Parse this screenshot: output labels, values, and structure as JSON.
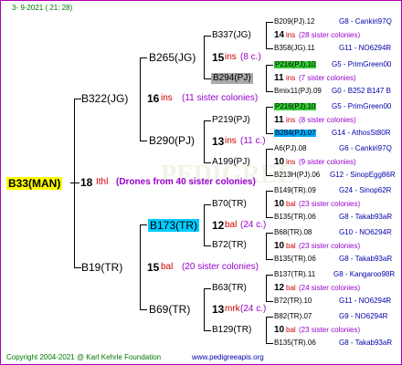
{
  "header": {
    "date": "3-  9-2021 ( 21: 28)"
  },
  "root": {
    "name": "B33(MAN)",
    "gen": "18",
    "ins": "Ithl",
    "note": "(Drones from 40 sister colonies)"
  },
  "gen1": [
    {
      "name": "B322(JG)",
      "gen": "16",
      "ins": "ins",
      "note": "(11 sister colonies)"
    },
    {
      "name": "B19(TR)",
      "gen": "15",
      "ins": "bal",
      "note": "(20 sister colonies)"
    }
  ],
  "gen2": [
    {
      "name": "B265(JG)",
      "gen": "15",
      "ins": "ins",
      "note": "(8 c.)"
    },
    {
      "name": "B290(PJ)",
      "gen": "13",
      "ins": "ins",
      "note": "(11 c.)"
    },
    {
      "name": "B173(TR)",
      "gen": "12",
      "ins": "bal",
      "note": "(24 c.)"
    },
    {
      "name": "B69(TR)",
      "gen": "13",
      "ins": "mrk",
      "note": "(24 c.)"
    }
  ],
  "gen3": [
    {
      "name": "B337(JG)",
      "gen": "14",
      "ins": "ins",
      "note": "(28 sister colonies)"
    },
    {
      "name": "B294(PJ)",
      "gen": "11",
      "ins": "ins",
      "note": "(7 sister colonies)"
    },
    {
      "name": "P219(PJ)",
      "gen": "11",
      "ins": "ins",
      "note": "(8 sister colonies)"
    },
    {
      "name": "A199(PJ)",
      "gen": "10",
      "ins": "ins",
      "note": "(9 sister colonies)"
    },
    {
      "name": "B70(TR)",
      "gen": "10",
      "ins": "bal",
      "note": "(23 sister colonies)"
    },
    {
      "name": "B72(TR)",
      "gen": "10",
      "ins": "bal",
      "note": "(23 sister colonies)"
    },
    {
      "name": "B63(TR)",
      "gen": "12",
      "ins": "bal",
      "note": "(24 sister colonies)"
    },
    {
      "name": "B129(TR)",
      "gen": "10",
      "ins": "bal",
      "note": "(23 sister colonies)"
    }
  ],
  "gen4": [
    {
      "name": "B209(PJ).12",
      "code": "G8 - Cankiri97Q"
    },
    {
      "name": "B358(JG).11",
      "code": "G11 - NO6294R"
    },
    {
      "name": "P216(PJ).10",
      "code": "G5 - PrimGreen00"
    },
    {
      "name": "Bmix11(PJ).09",
      "code": "G0 - B252 B147 B"
    },
    {
      "name": "P216(PJ).10",
      "code": "G5 - PrimGreen00"
    },
    {
      "name": "B284(PJ).07",
      "code": "G14 - AthosSt80R"
    },
    {
      "name": "A6(PJ).08",
      "code": "G6 - Cankiri97Q"
    },
    {
      "name": "B213H(PJ).06",
      "code": "G12 - SinopEgg86R"
    },
    {
      "name": "B149(TR).09",
      "code": "G24 - Sinop62R"
    },
    {
      "name": "B135(TR).06",
      "code": "G8 - Takab93aR"
    },
    {
      "name": "B68(TR).08",
      "code": "G10 - NO6294R"
    },
    {
      "name": "B135(TR).06",
      "code": "G8 - Takab93aR"
    },
    {
      "name": "B137(TR).11",
      "code": "G8 - Kangaroo98R"
    },
    {
      "name": "B72(TR).10",
      "code": "G11 - NO6294R"
    },
    {
      "name": "B82(TR).07",
      "code": "G9 - NO6294R"
    },
    {
      "name": "B135(TR).06",
      "code": "G8 - Takab93aR"
    }
  ],
  "footer": {
    "copyright": "Copyright 2004-2021 @ Karl Kehrle Foundation",
    "site": "www.pedigreeapis.org"
  },
  "colors": {
    "border": "#b000b0",
    "root_bg": "#ffff00",
    "cyan_bg": "#00ccff",
    "green_bg": "#33cc33",
    "gray_bg": "#a9a9a9",
    "blue_bg": "#00aaff"
  }
}
